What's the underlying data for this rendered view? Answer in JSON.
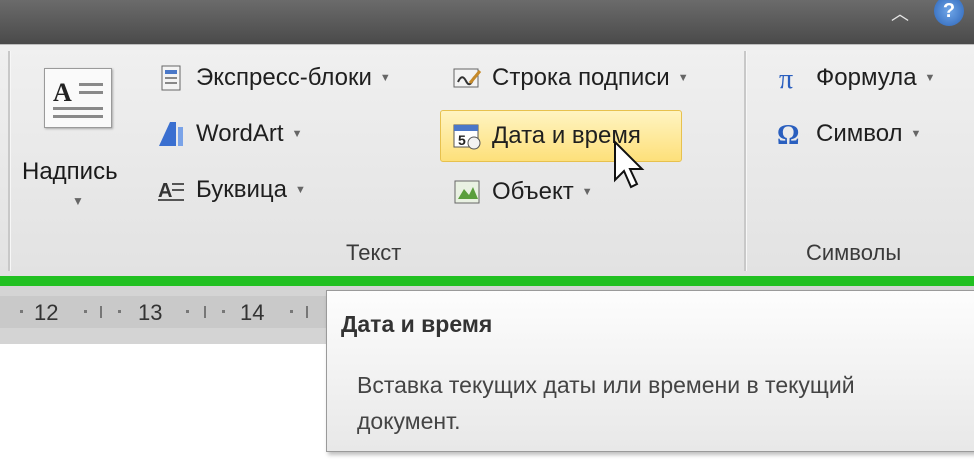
{
  "ribbon": {
    "nadpis": {
      "label": "Надпись",
      "icon": "text-box-icon"
    },
    "text_group": {
      "label": "Текст",
      "items": [
        {
          "label": "Экспресс-блоки",
          "icon": "quick-parts-icon",
          "dropdown": true
        },
        {
          "label": "WordArt",
          "icon": "wordart-icon",
          "dropdown": true
        },
        {
          "label": "Буквица",
          "icon": "drop-cap-icon",
          "dropdown": true
        },
        {
          "label": "Строка подписи",
          "icon": "signature-line-icon",
          "dropdown": true
        },
        {
          "label": "Дата и время",
          "icon": "date-time-icon",
          "dropdown": false,
          "highlighted": true
        },
        {
          "label": "Объект",
          "icon": "object-icon",
          "dropdown": true
        }
      ]
    },
    "symbols_group": {
      "label": "Символы",
      "items": [
        {
          "label": "Формула",
          "icon": "pi-icon",
          "dropdown": true
        },
        {
          "label": "Символ",
          "icon": "omega-icon",
          "dropdown": true
        }
      ]
    }
  },
  "ruler": {
    "numbers": [
      "12",
      "13",
      "14"
    ]
  },
  "tooltip": {
    "title": "Дата и время",
    "body": "Вставка текущих даты или времени в текущий документ."
  },
  "colors": {
    "highlight_border": "#21c021",
    "hover": "#fde07a"
  }
}
